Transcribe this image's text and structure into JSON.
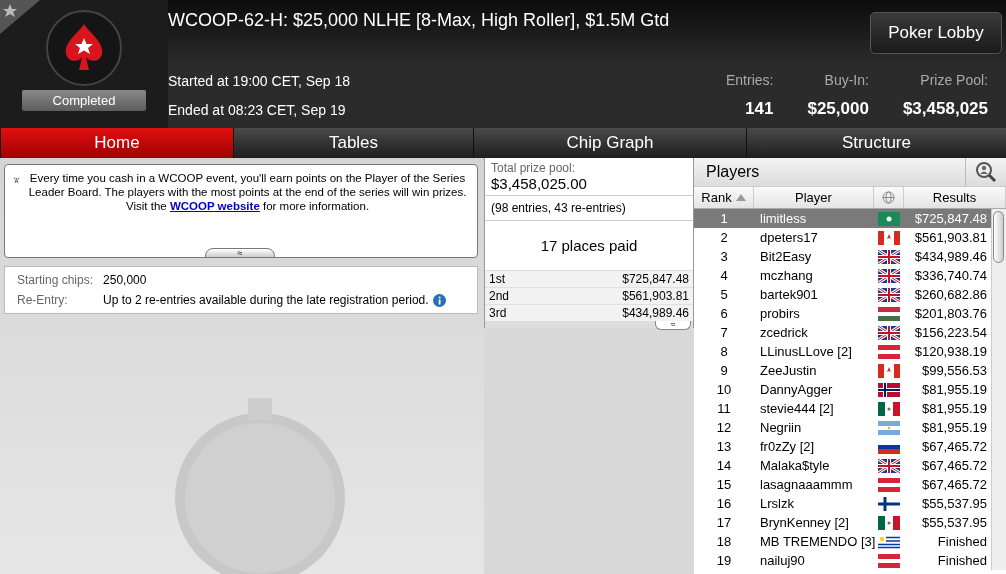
{
  "header": {
    "title": "WCOOP-62-H: $25,000 NLHE [8-Max, High Roller], $1.5M Gtd",
    "status": "Completed",
    "started": "Started at 19:00 CET, Sep 18",
    "ended": "Ended at 08:23 CET, Sep 19",
    "lobby_button": "Poker Lobby",
    "stats": [
      {
        "label": "Entries:",
        "value": "141"
      },
      {
        "label": "Buy-In:",
        "value": "$25,000"
      },
      {
        "label": "Prize Pool:",
        "value": "$3,458,025"
      }
    ]
  },
  "tabs": [
    {
      "label": "Home",
      "selected": true
    },
    {
      "label": "Tables",
      "selected": false
    },
    {
      "label": "Chip Graph",
      "selected": false
    },
    {
      "label": "Structure",
      "selected": false
    }
  ],
  "notice": {
    "text": "Every time you cash in a WCOOP event, you'll earn points on the Player of the Series Leader Board. The players with the most points at the end of the series will win prizes. Visit the ",
    "link": "WCOOP website",
    "after": " for more information.",
    "collapse": "≈"
  },
  "info": [
    {
      "label": "Starting chips:",
      "value": "250,000"
    },
    {
      "label": "Re-Entry:",
      "value": "Up to 2 re-entries available during the late registration period."
    }
  ],
  "prizes": {
    "label": "Total prize pool:",
    "total": "$3,458,025.00",
    "entries": "(98 entries, 43 re-entries)",
    "places": "17 places paid",
    "expand": "≈",
    "rows": [
      {
        "place": "1st",
        "amount": "$725,847.48"
      },
      {
        "place": "2nd",
        "amount": "$561,903.81"
      },
      {
        "place": "3rd",
        "amount": "$434,989.46"
      }
    ]
  },
  "players": {
    "title": "Players",
    "columns": [
      "Rank",
      "Player",
      "Results"
    ],
    "rows": [
      {
        "rank": "1",
        "name": "limitless",
        "kind": "macau",
        "result": "$725,847.48",
        "selected": true
      },
      {
        "rank": "2",
        "name": "dpeters17",
        "kind": "canada",
        "result": "$561,903.81",
        "selected": false
      },
      {
        "rank": "3",
        "name": "Bit2Easy",
        "kind": "uk",
        "result": "$434,989.46",
        "selected": false
      },
      {
        "rank": "4",
        "name": "mczhang",
        "kind": "uk",
        "result": "$336,740.74",
        "selected": false
      },
      {
        "rank": "5",
        "name": "bartek901",
        "kind": "uk",
        "result": "$260,682.86",
        "selected": false
      },
      {
        "rank": "6",
        "name": "probirs",
        "kind": "hungary",
        "result": "$201,803.76",
        "selected": false
      },
      {
        "rank": "7",
        "name": "zcedrick",
        "kind": "uk",
        "result": "$156,223.54",
        "selected": false
      },
      {
        "rank": "8",
        "name": "LLinusLLove [2]",
        "kind": "austria",
        "result": "$120,938.19",
        "selected": false
      },
      {
        "rank": "9",
        "name": "ZeeJustin",
        "kind": "canada",
        "result": "$99,556.53",
        "selected": false
      },
      {
        "rank": "10",
        "name": "DannyAgger",
        "kind": "norway",
        "result": "$81,955.19",
        "selected": false
      },
      {
        "rank": "11",
        "name": "stevie444 [2]",
        "kind": "mexico",
        "result": "$81,955.19",
        "selected": false
      },
      {
        "rank": "12",
        "name": "Negriin",
        "kind": "argentina",
        "result": "$81,955.19",
        "selected": false
      },
      {
        "rank": "13",
        "name": "fr0zZy [2]",
        "kind": "russia",
        "result": "$67,465.72",
        "selected": false
      },
      {
        "rank": "14",
        "name": "Malaka$tyle",
        "kind": "uk",
        "result": "$67,465.72",
        "selected": false
      },
      {
        "rank": "15",
        "name": "lasagnaaammm",
        "kind": "austria",
        "result": "$67,465.72",
        "selected": false
      },
      {
        "rank": "16",
        "name": "Lrslzk",
        "kind": "finland",
        "result": "$55,537.95",
        "selected": false
      },
      {
        "rank": "17",
        "name": "BrynKenney [2]",
        "kind": "mexico",
        "result": "$55,537.95",
        "selected": false
      },
      {
        "rank": "18",
        "name": "MB TREMENDO [3]",
        "kind": "uruguay",
        "result": "Finished",
        "selected": false
      },
      {
        "rank": "19",
        "name": "nailuj90",
        "kind": "austria",
        "result": "Finished",
        "selected": false
      }
    ]
  }
}
